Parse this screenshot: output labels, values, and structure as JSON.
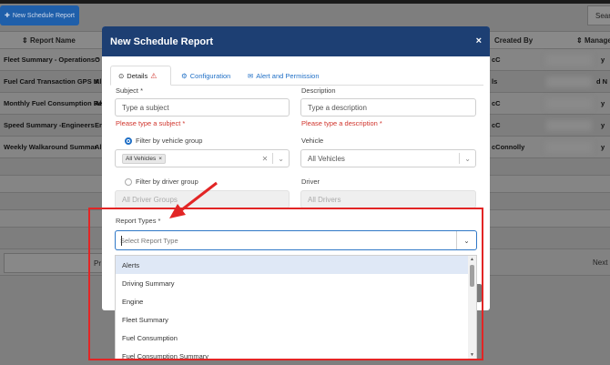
{
  "background": {
    "new_button_label": "New Schedule Report",
    "search_label": "Sear",
    "columns": {
      "report_name": "Report Name",
      "created_by": "Created By",
      "manage": "Manage"
    },
    "rows": [
      {
        "name": "Fleet Summary - Operations ‘",
        "small": "O",
        "c": "cC",
        "y": "y"
      },
      {
        "name": "Fuel Card Transaction GPS M",
        "small": "Al",
        "c": "ls",
        "y": "d N"
      },
      {
        "name": "Monthly Fuel Consumption Re",
        "small": "Al",
        "c": "cC",
        "y": "y"
      },
      {
        "name": "Speed Summary -Engineers",
        "small": "Er",
        "c": "cC",
        "y": "y"
      },
      {
        "name": "Weekly Walkaround Summar",
        "small": "Al",
        "c": "cConnolly",
        "y": "y"
      }
    ],
    "pager_prev": "Pr",
    "pager_next": "Next"
  },
  "modal": {
    "title": "New Schedule Report",
    "close": "×",
    "tabs": [
      {
        "label": "Details",
        "icon": "clock-icon",
        "warning": "⚠"
      },
      {
        "label": "Configuration",
        "icon": "gear-icon"
      },
      {
        "label": "Alert and Permission",
        "icon": "envelope-icon"
      }
    ],
    "subject": {
      "label": "Subject *",
      "placeholder": "Type a subject",
      "error": "Please type a subject *"
    },
    "description": {
      "label": "Description",
      "placeholder": "Type a description",
      "error": "Please type a description *"
    },
    "filter_vehicle_group": {
      "label": "Filter by vehicle group",
      "selected": true
    },
    "vehicle_group_chip": "All Vehicles",
    "vehicle": {
      "label": "Vehicle",
      "value": "All Vehicles"
    },
    "filter_driver_group": {
      "label": "Filter by driver group",
      "selected": false
    },
    "driver_groups": "All Driver Groups",
    "driver": {
      "label": "Driver",
      "value": "All Drivers"
    },
    "report_types": {
      "label": "Report Types *",
      "placeholder": "Select Report Type",
      "options": [
        "Alerts",
        "Driving Summary",
        "Engine",
        "Fleet Summary",
        "Fuel Consumption",
        "Fuel Consumption Summary"
      ],
      "highlighted": "Alerts"
    }
  },
  "colors": {
    "header": "#1d3f73",
    "accent": "#1f6fc6",
    "error": "#d0342c",
    "annotation": "#e22525"
  }
}
